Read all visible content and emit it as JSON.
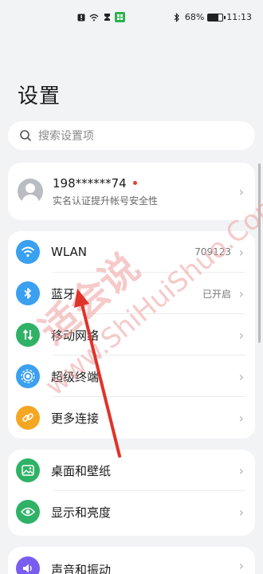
{
  "status_bar": {
    "left_icons": [
      "alert-icon",
      "wifi-small-icon",
      "sim-icon",
      "app-badge-icon"
    ],
    "bluetooth_icon": "bluetooth-icon",
    "battery_percent": "68%",
    "battery_level": 0.68,
    "time": "11:13"
  },
  "page_title": "设置",
  "search": {
    "placeholder": "搜索设置项"
  },
  "account": {
    "name": "198******74",
    "subtitle": "实名认证提升帐号安全性"
  },
  "group1": [
    {
      "label": "WLAN",
      "value": "709123",
      "icon": "wifi-icon",
      "color": "#3aa0f0"
    },
    {
      "label": "蓝牙",
      "value": "已开启",
      "icon": "bluetooth-icon",
      "color": "#3aa0f0"
    },
    {
      "label": "移动网络",
      "value": "",
      "icon": "mobile-data-icon",
      "color": "#2fb266"
    },
    {
      "label": "超级终端",
      "value": "",
      "icon": "super-device-icon",
      "color": "#3aa0f0"
    },
    {
      "label": "更多连接",
      "value": "",
      "icon": "link-icon",
      "color": "#f5a623"
    }
  ],
  "group2": [
    {
      "label": "桌面和壁纸",
      "icon": "wallpaper-icon",
      "color": "#2fb266"
    },
    {
      "label": "显示和亮度",
      "icon": "eye-icon",
      "color": "#2fb266"
    }
  ],
  "group3": [
    {
      "label": "声音和振动",
      "icon": "speaker-icon",
      "color": "#7b5cf0"
    }
  ],
  "watermark": {
    "cn": "适会说",
    "en": "www.ShiHuiShuo.Com",
    "color": "#f0a0a0"
  },
  "annotation": {
    "arrow_color": "#e0332a"
  }
}
